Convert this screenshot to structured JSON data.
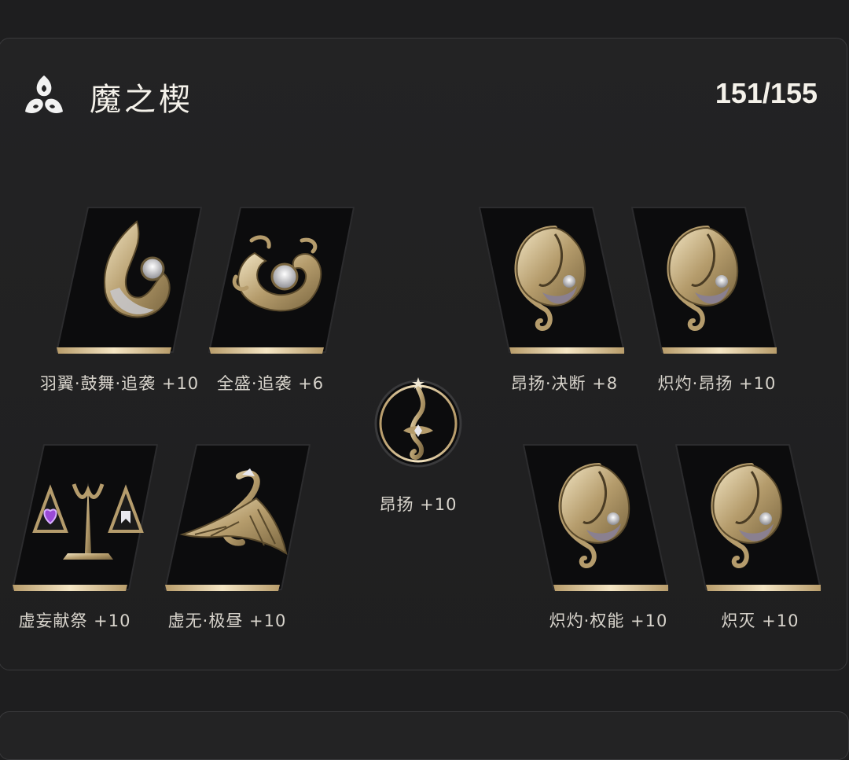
{
  "header": {
    "icon": "tri-spiral-emblem-icon",
    "title": "魔之楔",
    "count": "151/155"
  },
  "cards": [
    {
      "label": "羽翼·鼓舞·追袭 +10",
      "icon": "wing-swirl-emblem-icon"
    },
    {
      "label": "全盛·追袭 +6",
      "icon": "dragon-ring-emblem-icon"
    },
    {
      "label": "昂扬·决断 +8",
      "icon": "mask-moon-emblem-icon"
    },
    {
      "label": "炽灼·昂扬 +10",
      "icon": "mask-moon-emblem-icon"
    },
    {
      "label": "虚妄献祭 +10",
      "icon": "balance-scale-emblem-icon"
    },
    {
      "label": "虚无·极昼 +10",
      "icon": "phoenix-emblem-icon"
    },
    {
      "label": "炽灼·权能 +10",
      "icon": "mask-moon-emblem-icon"
    },
    {
      "label": "炽灭 +10",
      "icon": "mask-moon-emblem-icon"
    }
  ],
  "center": {
    "label": "昂扬 +10",
    "icon": "serpent-medallion-icon"
  },
  "colors": {
    "gold": "#c9b48a",
    "card_bg": "#0c0c0d",
    "panel_bg": "#232324"
  }
}
